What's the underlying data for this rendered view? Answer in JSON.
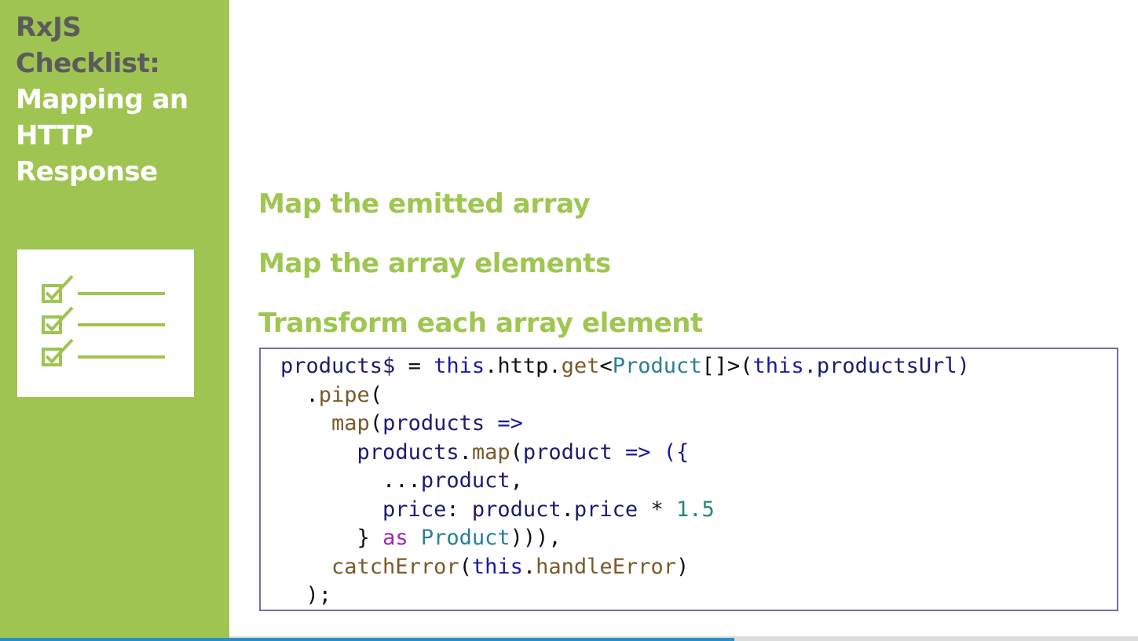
{
  "sidebar": {
    "title_line1": "RxJS",
    "title_line2": "Checklist:",
    "title_line3": "Mapping an",
    "title_line4": "HTTP",
    "title_line5": "Response",
    "icon": "checklist-icon",
    "accent_color": "#a0c452"
  },
  "points": [
    "Map the emitted array",
    "Map the array elements",
    "Transform each array element"
  ],
  "code": {
    "l1": {
      "a": "products$",
      "b": " = ",
      "c": "this",
      "d": ".http.",
      "e": "get",
      "f": "<",
      "g": "Product",
      "h": "[]>(",
      "i": "this",
      "j": ".productsUrl)"
    },
    "l2": {
      "a": ".",
      "b": "pipe",
      "c": "("
    },
    "l3": {
      "a": "map",
      "b": "(",
      "c": "products",
      "d": " =>"
    },
    "l4": {
      "a": "products",
      "b": ".",
      "c": "map",
      "d": "(",
      "e": "product",
      "f": " => ({"
    },
    "l5": {
      "a": "...",
      "b": "product",
      "c": ","
    },
    "l6": {
      "a": "price",
      "b": ": ",
      "c": "product",
      "d": ".",
      "e": "price",
      "f": " * ",
      "g": "1.5"
    },
    "l7": {
      "a": "} ",
      "b": "as",
      "c": " ",
      "d": "Product",
      "e": "))),"
    },
    "l8": {
      "a": "catchError",
      "b": "(",
      "c": "this",
      "d": ".",
      "e": "handleError",
      "f": ")"
    },
    "l9": {
      "a": ");"
    }
  },
  "progress": {
    "value_fraction": 0.645,
    "color": "#2a8ec7"
  }
}
